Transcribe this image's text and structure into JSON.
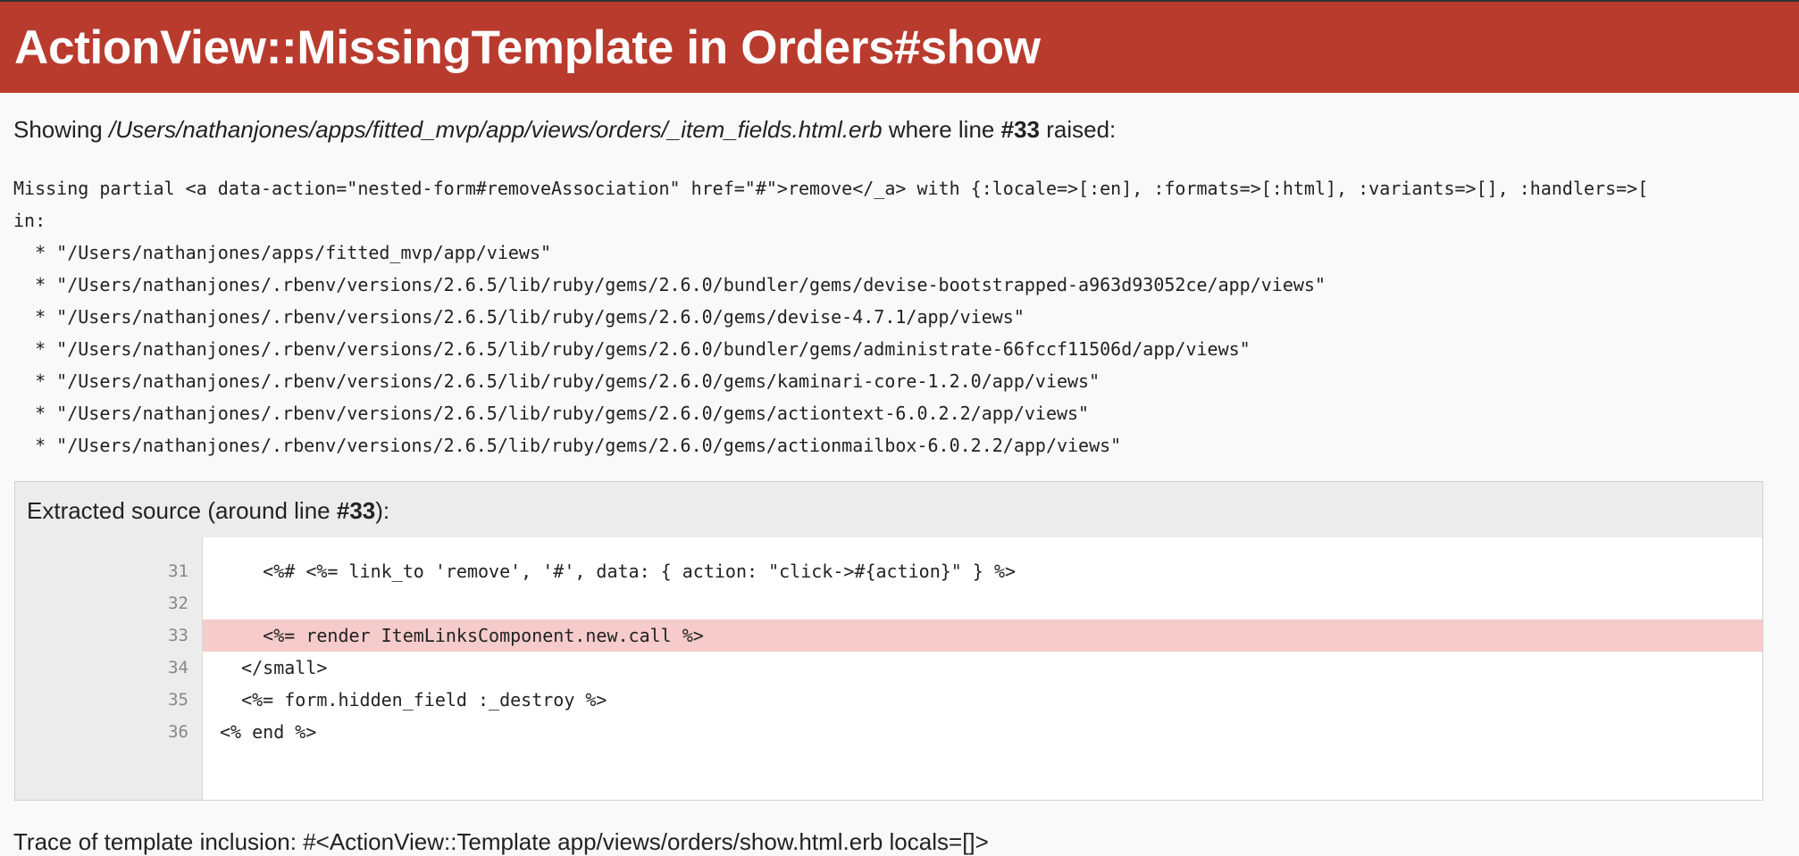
{
  "header": {
    "title": "ActionView::MissingTemplate in Orders#show"
  },
  "showing": {
    "prefix": "Showing",
    "path": "/Users/nathanjones/apps/fitted_mvp/app/views/orders/_item_fields.html.erb",
    "middle": "where line",
    "line": "#33",
    "suffix": "raised:"
  },
  "error_message": {
    "lines": [
      "Missing partial <a data-action=\"nested-form#removeAssociation\" href=\"#\">remove</_a> with {:locale=>[:en], :formats=>[:html], :variants=>[], :handlers=>[",
      "in:",
      "  * \"/Users/nathanjones/apps/fitted_mvp/app/views\"",
      "  * \"/Users/nathanjones/.rbenv/versions/2.6.5/lib/ruby/gems/2.6.0/bundler/gems/devise-bootstrapped-a963d93052ce/app/views\"",
      "  * \"/Users/nathanjones/.rbenv/versions/2.6.5/lib/ruby/gems/2.6.0/gems/devise-4.7.1/app/views\"",
      "  * \"/Users/nathanjones/.rbenv/versions/2.6.5/lib/ruby/gems/2.6.0/bundler/gems/administrate-66fccf11506d/app/views\"",
      "  * \"/Users/nathanjones/.rbenv/versions/2.6.5/lib/ruby/gems/2.6.0/gems/kaminari-core-1.2.0/app/views\"",
      "  * \"/Users/nathanjones/.rbenv/versions/2.6.5/lib/ruby/gems/2.6.0/gems/actiontext-6.0.2.2/app/views\"",
      "  * \"/Users/nathanjones/.rbenv/versions/2.6.5/lib/ruby/gems/2.6.0/gems/actionmailbox-6.0.2.2/app/views\""
    ]
  },
  "extracted_source": {
    "title_prefix": "Extracted source (around line",
    "title_line": "#33",
    "title_suffix": "):",
    "highlight_line": "33",
    "lines": [
      {
        "number": "31",
        "code": "    <%# <%= link_to 'remove', '#', data: { action: \"click->#{action}\" } %>"
      },
      {
        "number": "32",
        "code": ""
      },
      {
        "number": "33",
        "code": "    <%= render ItemLinksComponent.new.call %>"
      },
      {
        "number": "34",
        "code": "  </small>"
      },
      {
        "number": "35",
        "code": "  <%= form.hidden_field :_destroy %>"
      },
      {
        "number": "36",
        "code": "<% end %>"
      }
    ]
  },
  "trace": {
    "text": "Trace of template inclusion: #<ActionView::Template app/views/orders/show.html.erb locals=[]>"
  },
  "colors": {
    "header_bg": "#b93b2e",
    "highlight_bg": "#f6cbcb",
    "page_bg": "#f9f9f9"
  }
}
